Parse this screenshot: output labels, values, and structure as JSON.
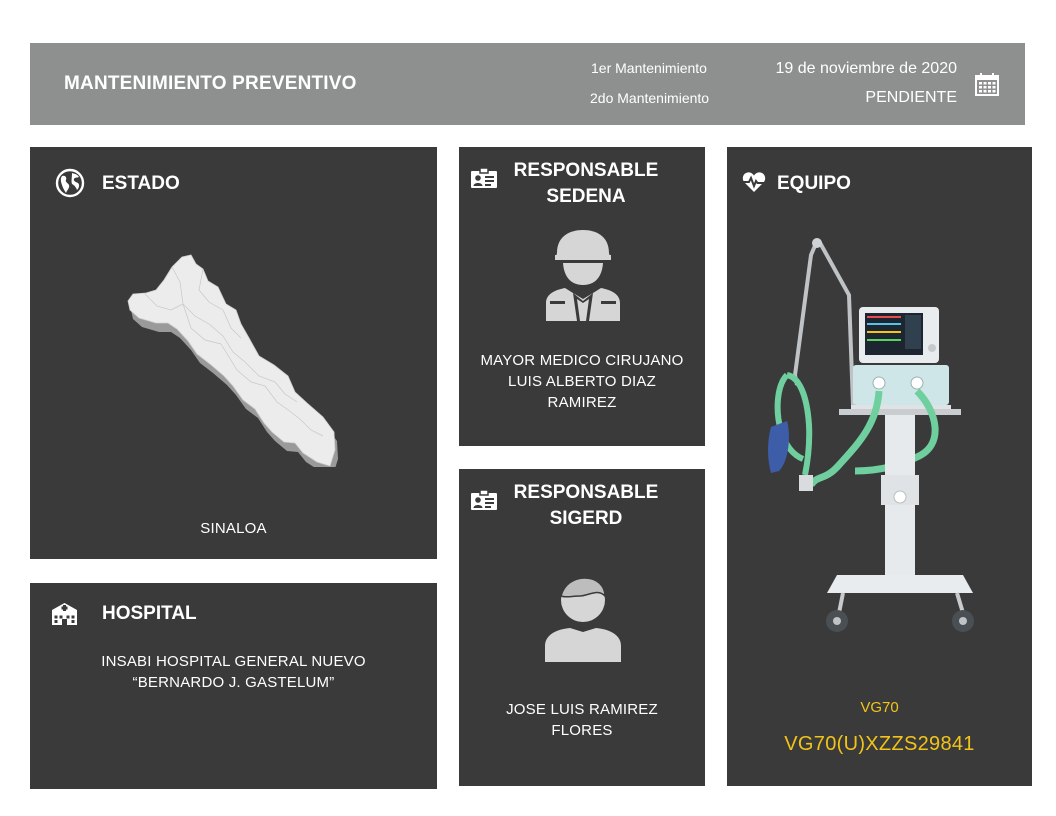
{
  "header": {
    "title": "MANTENIMIENTO PREVENTIVO",
    "label_first": "1er Mantenimiento",
    "label_second": "2do Mantenimiento",
    "value_first": "19 de noviembre de 2020",
    "value_second": "PENDIENTE",
    "icon": "calendar-icon"
  },
  "estado": {
    "title": "ESTADO",
    "icon": "globe-icon",
    "map_icon": "sinaloa-map",
    "value": "SINALOA"
  },
  "hospital": {
    "title": "HOSPITAL",
    "icon": "hospital-icon",
    "line1": "INSABI HOSPITAL GENERAL NUEVO",
    "line2": "“BERNARDO J. GASTELUM”"
  },
  "sedena": {
    "title_line1": "RESPONSABLE",
    "title_line2": "SEDENA",
    "icon": "id-card-icon",
    "avatar": "soldier-avatar-icon",
    "line1": "MAYOR MEDICO CIRUJANO",
    "line2": "LUIS ALBERTO DIAZ",
    "line3": "RAMIREZ"
  },
  "sigerd": {
    "title_line1": "RESPONSABLE",
    "title_line2": "SIGERD",
    "icon": "id-card-icon",
    "avatar": "person-avatar-icon",
    "line1": "JOSE LUIS RAMIREZ",
    "line2": "FLORES"
  },
  "equipo": {
    "title": "EQUIPO",
    "icon": "heart-pulse-icon",
    "image": "ventilator-image",
    "model": "VG70",
    "serial": "VG70(U)XZZS29841"
  },
  "colors": {
    "header_bg": "#8e9090",
    "card_bg": "#3a3a3a",
    "accent": "#f2c418"
  }
}
